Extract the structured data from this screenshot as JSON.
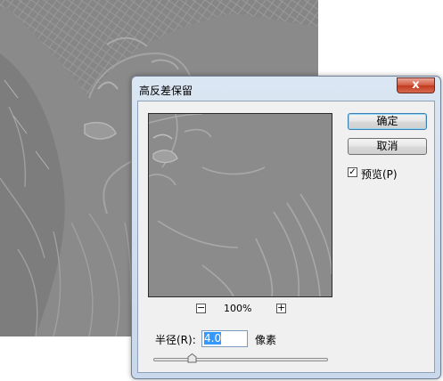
{
  "dialog": {
    "title": "高反差保留",
    "close_symbol": "x",
    "ok_label": "确定",
    "cancel_label": "取消",
    "preview_checkbox": {
      "label": "预览(P)",
      "checked": true
    },
    "zoom": {
      "value": "100%",
      "minus": "−",
      "plus": "+"
    },
    "radius": {
      "label": "半径(R):",
      "value": "4.0",
      "unit": "像素",
      "slider_fraction": 0.22
    }
  },
  "icons": [
    "close-icon",
    "zoom-out-icon",
    "zoom-in-icon",
    "checkmark-icon",
    "slider-thumb-icon"
  ]
}
